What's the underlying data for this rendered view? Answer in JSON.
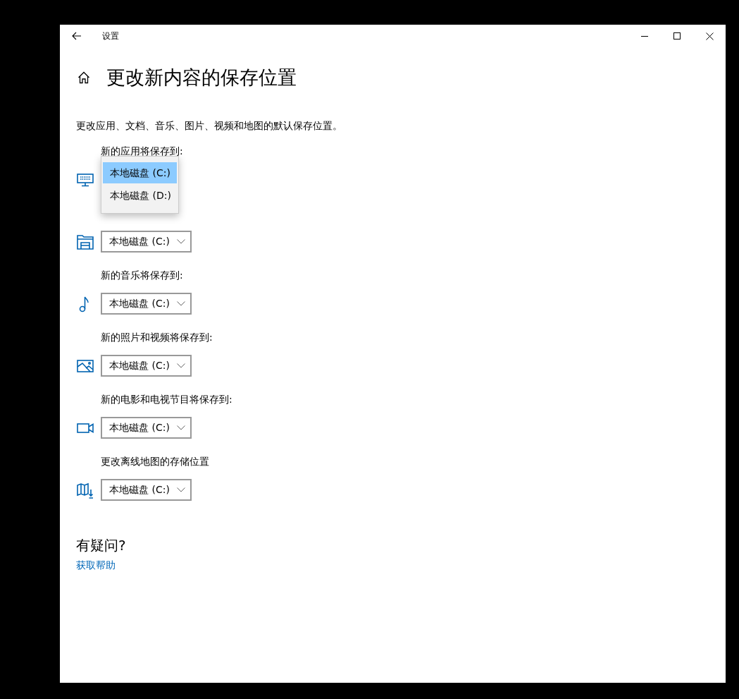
{
  "window": {
    "title": "设置"
  },
  "page": {
    "title": "更改新内容的保存位置",
    "description": "更改应用、文档、音乐、图片、视频和地图的默认保存位置。"
  },
  "rows": [
    {
      "kind": "apps",
      "label": "新的应用将保存到:",
      "open": true,
      "options": [
        {
          "label": "本地磁盘 (C:)",
          "selected": true
        },
        {
          "label": "本地磁盘 (D:)",
          "selected": false
        }
      ]
    },
    {
      "kind": "documents",
      "open": false,
      "value": "本地磁盘 (C:)"
    },
    {
      "kind": "music",
      "label": "新的音乐将保存到:",
      "open": false,
      "value": "本地磁盘 (C:)"
    },
    {
      "kind": "photos",
      "label": "新的照片和视频将保存到:",
      "open": false,
      "value": "本地磁盘 (C:)"
    },
    {
      "kind": "movies",
      "label": "新的电影和电视节目将保存到:",
      "open": false,
      "value": "本地磁盘 (C:)"
    },
    {
      "kind": "maps",
      "label": "更改离线地图的存储位置",
      "open": false,
      "value": "本地磁盘 (C:)"
    }
  ],
  "help": {
    "title": "有疑问?",
    "link": "获取帮助"
  }
}
